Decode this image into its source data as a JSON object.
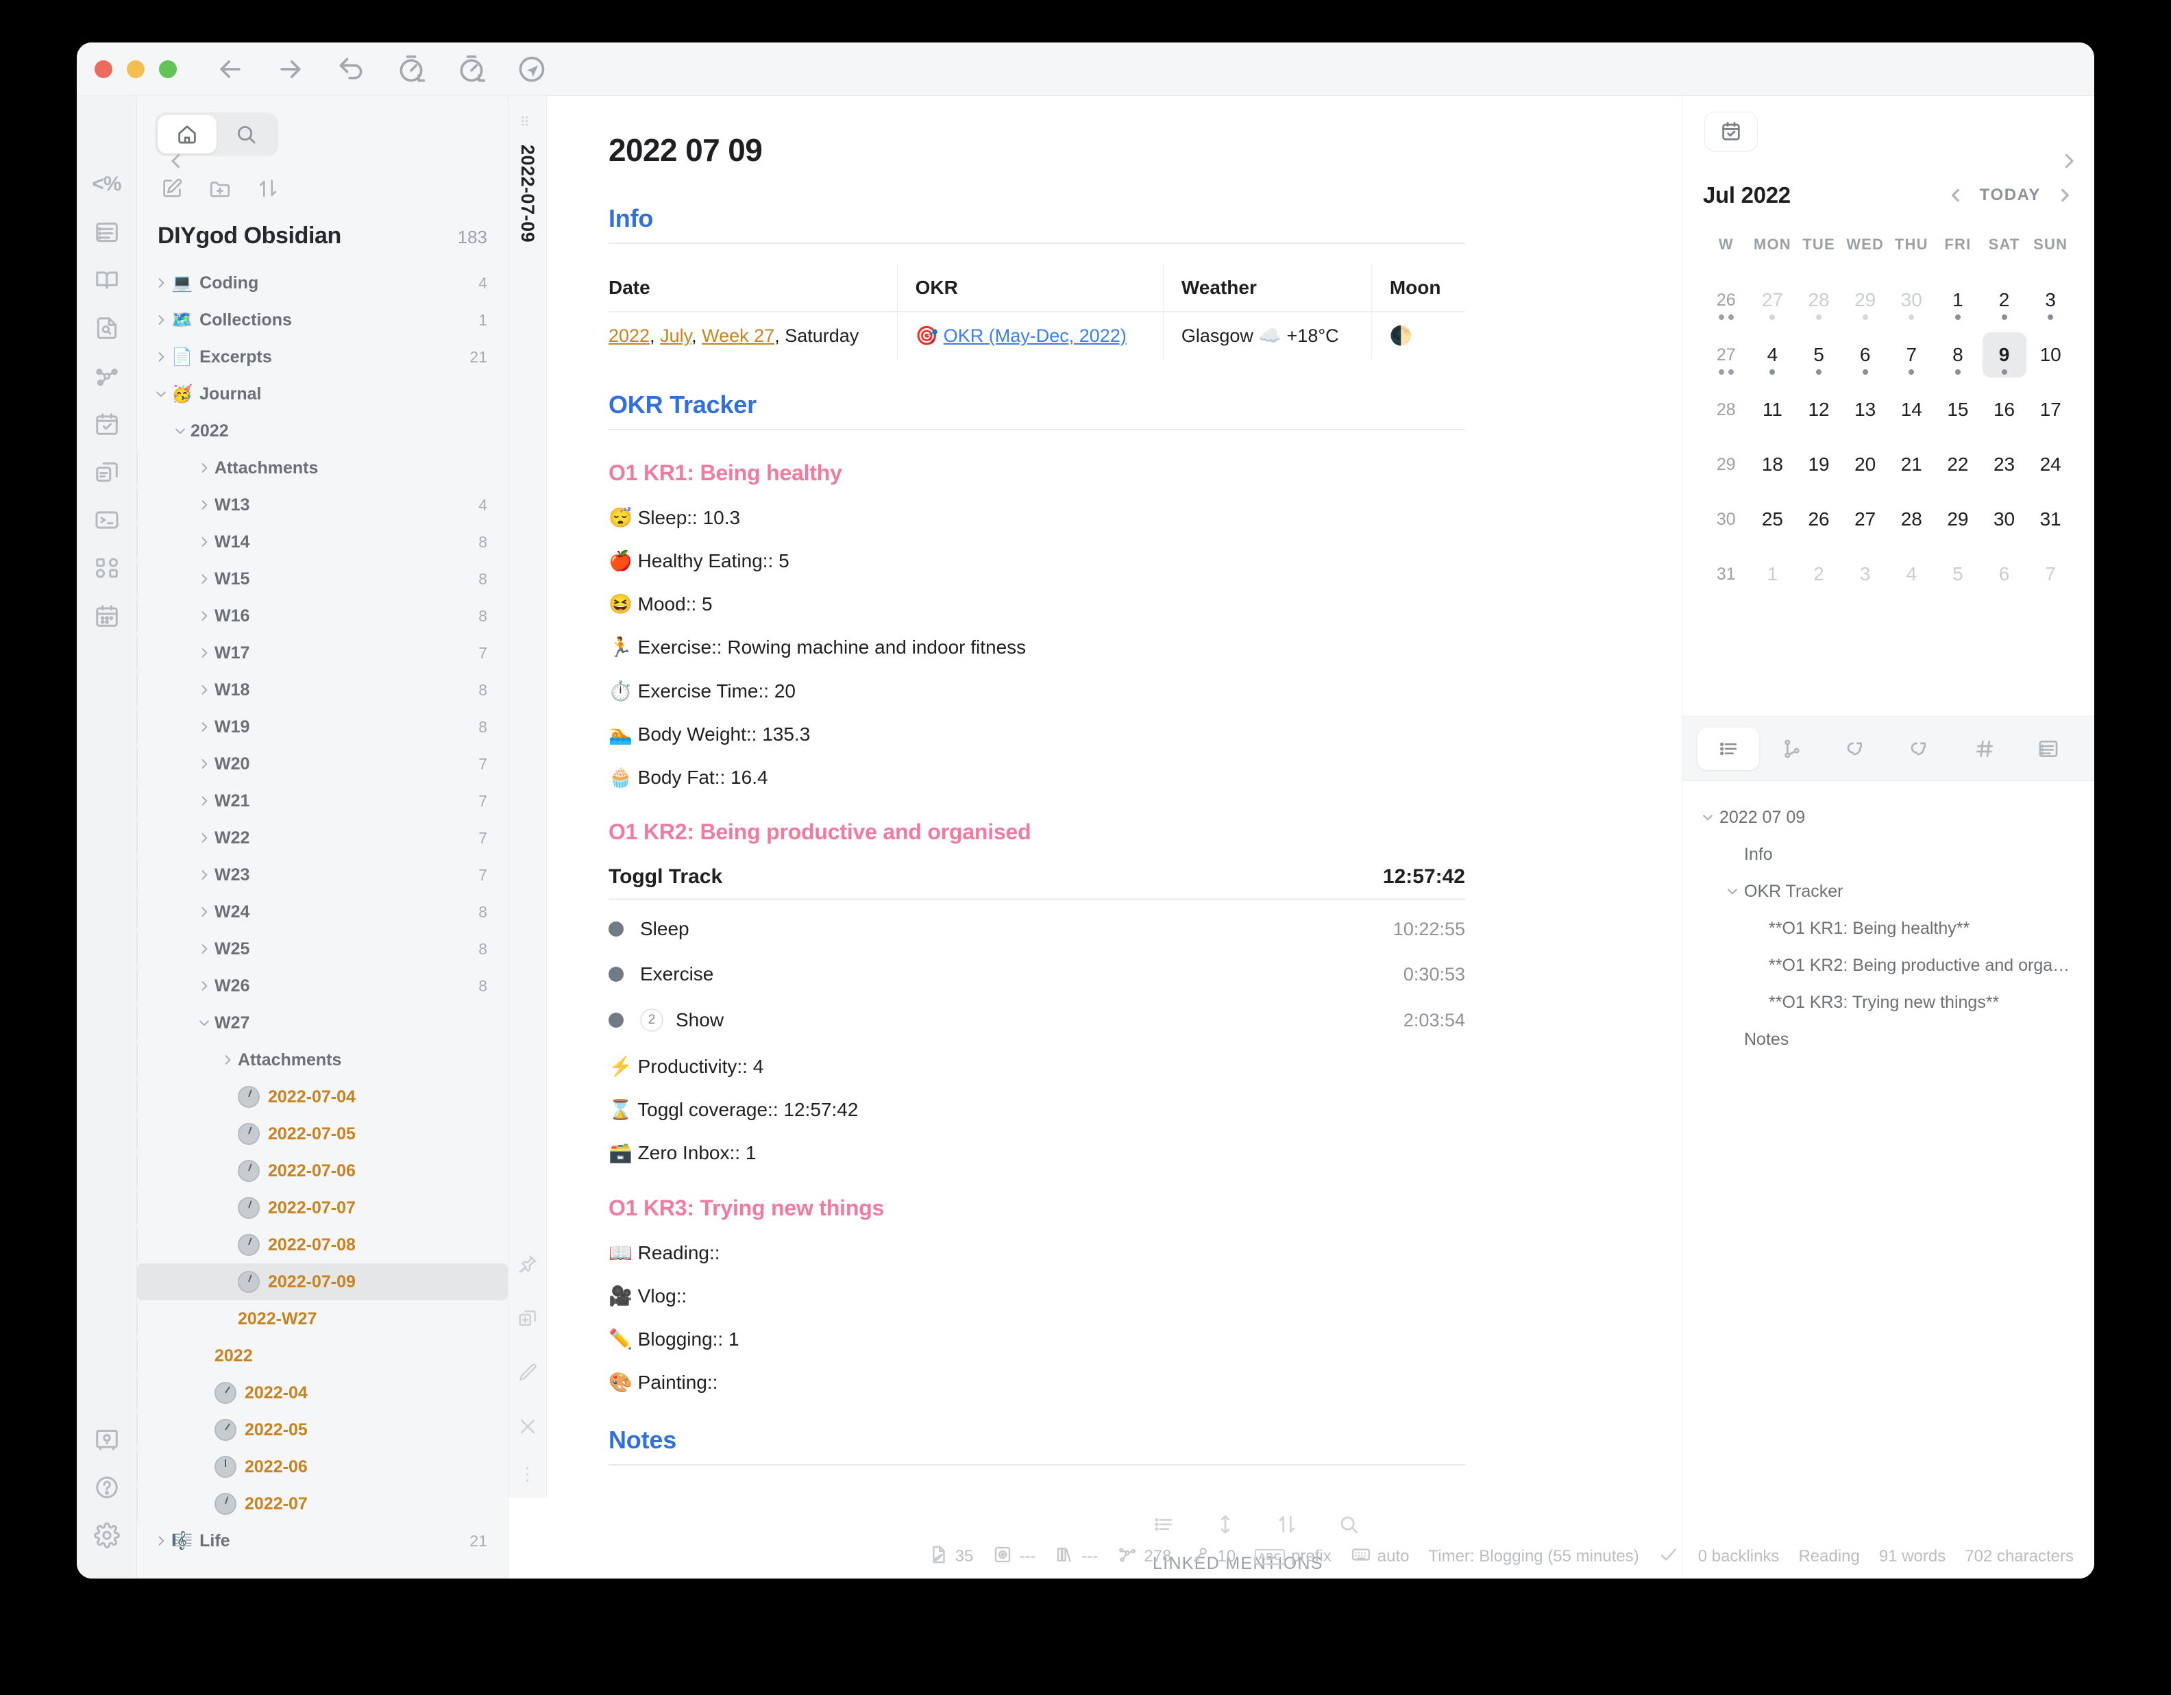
{
  "titlebar": {
    "nav": [
      "back-arrow",
      "forward-arrow",
      "undo-arrow",
      "redo-clock-a",
      "redo-clock-b",
      "navigate-circle"
    ]
  },
  "ribbon": {
    "items": [
      "list-panel-icon",
      "book-icon",
      "file-search-icon",
      "graph-icon",
      "calendar-check-icon",
      "copy-panes-icon",
      "terminal-icon",
      "blocks-icon",
      "calendar-days-icon"
    ],
    "bottom": [
      "vault-icon",
      "help-icon",
      "settings-icon"
    ],
    "percent_label": "<%"
  },
  "explorer": {
    "tabs": [
      "home-icon",
      "search-icon"
    ],
    "actions": [
      "new-note-icon",
      "new-folder-icon",
      "sort-icon"
    ],
    "vault_name": "DIYgod Obsidian",
    "vault_count": "183",
    "tree": [
      {
        "label": "Coding",
        "emoji": "💻",
        "count": "4",
        "indent": 0,
        "chevron": "right",
        "type": "folder"
      },
      {
        "label": "Collections",
        "emoji": "🗺️",
        "count": "1",
        "indent": 0,
        "chevron": "right",
        "type": "folder"
      },
      {
        "label": "Excerpts",
        "emoji": "📄",
        "count": "21",
        "indent": 0,
        "chevron": "right",
        "type": "folder"
      },
      {
        "label": "Journal",
        "emoji": "🥳",
        "count": "",
        "indent": 0,
        "chevron": "down",
        "type": "folder"
      },
      {
        "label": "2022",
        "emoji": "",
        "count": "",
        "indent": 1,
        "chevron": "down",
        "type": "folder"
      },
      {
        "label": "Attachments",
        "emoji": "",
        "count": "",
        "indent": 2,
        "chevron": "right",
        "type": "folder"
      },
      {
        "label": "W13",
        "emoji": "",
        "count": "4",
        "indent": 2,
        "chevron": "right",
        "type": "folder"
      },
      {
        "label": "W14",
        "emoji": "",
        "count": "8",
        "indent": 2,
        "chevron": "right",
        "type": "folder"
      },
      {
        "label": "W15",
        "emoji": "",
        "count": "8",
        "indent": 2,
        "chevron": "right",
        "type": "folder"
      },
      {
        "label": "W16",
        "emoji": "",
        "count": "8",
        "indent": 2,
        "chevron": "right",
        "type": "folder"
      },
      {
        "label": "W17",
        "emoji": "",
        "count": "7",
        "indent": 2,
        "chevron": "right",
        "type": "folder"
      },
      {
        "label": "W18",
        "emoji": "",
        "count": "8",
        "indent": 2,
        "chevron": "right",
        "type": "folder"
      },
      {
        "label": "W19",
        "emoji": "",
        "count": "8",
        "indent": 2,
        "chevron": "right",
        "type": "folder"
      },
      {
        "label": "W20",
        "emoji": "",
        "count": "7",
        "indent": 2,
        "chevron": "right",
        "type": "folder"
      },
      {
        "label": "W21",
        "emoji": "",
        "count": "7",
        "indent": 2,
        "chevron": "right",
        "type": "folder"
      },
      {
        "label": "W22",
        "emoji": "",
        "count": "7",
        "indent": 2,
        "chevron": "right",
        "type": "folder"
      },
      {
        "label": "W23",
        "emoji": "",
        "count": "7",
        "indent": 2,
        "chevron": "right",
        "type": "folder"
      },
      {
        "label": "W24",
        "emoji": "",
        "count": "8",
        "indent": 2,
        "chevron": "right",
        "type": "folder"
      },
      {
        "label": "W25",
        "emoji": "",
        "count": "8",
        "indent": 2,
        "chevron": "right",
        "type": "folder"
      },
      {
        "label": "W26",
        "emoji": "",
        "count": "8",
        "indent": 2,
        "chevron": "right",
        "type": "folder"
      },
      {
        "label": "W27",
        "emoji": "",
        "count": "",
        "indent": 2,
        "chevron": "down",
        "type": "folder"
      },
      {
        "label": "Attachments",
        "emoji": "",
        "count": "",
        "indent": 3,
        "chevron": "right",
        "type": "folder"
      },
      {
        "label": "2022-07-04",
        "emoji": "",
        "count": "",
        "indent": 3,
        "chevron": "",
        "type": "file",
        "clock": "h1"
      },
      {
        "label": "2022-07-05",
        "emoji": "",
        "count": "",
        "indent": 3,
        "chevron": "",
        "type": "file",
        "clock": "h1"
      },
      {
        "label": "2022-07-06",
        "emoji": "",
        "count": "",
        "indent": 3,
        "chevron": "",
        "type": "file",
        "clock": "h1"
      },
      {
        "label": "2022-07-07",
        "emoji": "",
        "count": "",
        "indent": 3,
        "chevron": "",
        "type": "file",
        "clock": "h1"
      },
      {
        "label": "2022-07-08",
        "emoji": "",
        "count": "",
        "indent": 3,
        "chevron": "",
        "type": "file",
        "clock": "h1"
      },
      {
        "label": "2022-07-09",
        "emoji": "",
        "count": "",
        "indent": 3,
        "chevron": "",
        "type": "file",
        "clock": "h1",
        "selected": true
      },
      {
        "label": "2022-W27",
        "emoji": "",
        "count": "",
        "indent": 3,
        "chevron": "",
        "type": "file-plain"
      },
      {
        "label": "2022",
        "emoji": "",
        "count": "",
        "indent": 2,
        "chevron": "",
        "type": "file-plain"
      },
      {
        "label": "2022-04",
        "emoji": "",
        "count": "",
        "indent": 2,
        "chevron": "",
        "type": "file",
        "clock": "h2"
      },
      {
        "label": "2022-05",
        "emoji": "",
        "count": "",
        "indent": 2,
        "chevron": "",
        "type": "file",
        "clock": "h2"
      },
      {
        "label": "2022-06",
        "emoji": "",
        "count": "",
        "indent": 2,
        "chevron": "",
        "type": "file",
        "clock": "h3"
      },
      {
        "label": "2022-07",
        "emoji": "",
        "count": "",
        "indent": 2,
        "chevron": "",
        "type": "file",
        "clock": "h4"
      },
      {
        "label": "Life",
        "emoji": "🎼",
        "count": "21",
        "indent": 0,
        "chevron": "right",
        "type": "folder"
      }
    ]
  },
  "tab": {
    "vertical_label": "2022-07-09"
  },
  "document": {
    "title": "2022 07 09",
    "info_heading": "Info",
    "info_table": {
      "headers": [
        "Date",
        "OKR",
        "Weather",
        "Moon"
      ],
      "row": {
        "date_year": "2022",
        "date_month": "July",
        "date_week": "Week 27",
        "date_weekday": ", Saturday",
        "okr_emoji": "🎯",
        "okr_link": "OKR (May-Dec, 2022)",
        "weather": "Glasgow ☁️ +18°C",
        "moon": "🌓"
      }
    },
    "okr_heading": "OKR Tracker",
    "kr1": {
      "title": "O1 KR1: Being healthy",
      "items": [
        {
          "emoji": "😴",
          "text": "Sleep:: 10.3"
        },
        {
          "emoji": "🍎",
          "text": "Healthy Eating:: 5"
        },
        {
          "emoji": "😆",
          "text": "Mood:: 5"
        },
        {
          "emoji": "🏃",
          "text": "Exercise:: Rowing machine and indoor fitness"
        },
        {
          "emoji": "⏱️",
          "text": "Exercise Time:: 20"
        },
        {
          "emoji": "🏊",
          "text": "Body Weight:: 135.3"
        },
        {
          "emoji": "🧁",
          "text": "Body Fat:: 16.4"
        }
      ]
    },
    "kr2": {
      "title": "O1 KR2: Being productive and organised",
      "toggl_label": "Toggl Track",
      "toggl_total": "12:57:42",
      "toggl_rows": [
        {
          "name": "Sleep",
          "time": "10:22:55",
          "badge": ""
        },
        {
          "name": "Exercise",
          "time": "0:30:53",
          "badge": ""
        },
        {
          "name": "Show",
          "time": "2:03:54",
          "badge": "2"
        }
      ],
      "items": [
        {
          "emoji": "⚡",
          "text": "Productivity:: 4"
        },
        {
          "emoji": "⌛",
          "text": "Toggl coverage:: 12:57:42"
        },
        {
          "emoji": "🗃️",
          "text": "Zero Inbox:: 1"
        }
      ]
    },
    "kr3": {
      "title": "O1 KR3: Trying new things",
      "items": [
        {
          "emoji": "📖",
          "text": "Reading::"
        },
        {
          "emoji": "🎥",
          "text": "Vlog::"
        },
        {
          "emoji": "✏️",
          "text": "Blogging:: 1"
        },
        {
          "emoji": "🎨",
          "text": "Painting::"
        }
      ]
    },
    "notes_heading": "Notes",
    "linked_mentions": "LINKED MENTIONS"
  },
  "editor_toolbar": [
    "list-icon",
    "vertical-resize-icon",
    "sort-updown-icon",
    "search-icon"
  ],
  "tab_tools": [
    "pin-icon",
    "add-pane-icon",
    "pencil-icon",
    "close-icon",
    "more-dots-icon"
  ],
  "statusbar": [
    {
      "icon": "note-edit-icon",
      "text": "35"
    },
    {
      "icon": "vault-icon",
      "text": "---"
    },
    {
      "icon": "books-icon",
      "text": "---"
    },
    {
      "icon": "graph-icon",
      "text": "278"
    },
    {
      "icon": "key-icon",
      "text": "10"
    },
    {
      "icon": "abc-icon",
      "text": "prefix"
    },
    {
      "icon": "keyboard-icon",
      "text": "auto"
    },
    {
      "icon": "",
      "text": "Timer: Blogging (55 minutes)"
    },
    {
      "icon": "check-icon",
      "text": ""
    },
    {
      "icon": "",
      "text": "0 backlinks"
    },
    {
      "icon": "",
      "text": "Reading"
    },
    {
      "icon": "",
      "text": "91 words"
    },
    {
      "icon": "",
      "text": "702 characters"
    }
  ],
  "right_panel": {
    "header_icon": "calendar-check-icon",
    "calendar": {
      "title": "Jul 2022",
      "today_label": "TODAY",
      "weekdays": [
        "W",
        "MON",
        "TUE",
        "WED",
        "THU",
        "FRI",
        "SAT",
        "SUN"
      ],
      "weeks": [
        {
          "w": "26",
          "wdots": 2,
          "days": [
            {
              "d": "27",
              "out": true,
              "dot": "faint"
            },
            {
              "d": "28",
              "out": true,
              "dot": "faint"
            },
            {
              "d": "29",
              "out": true,
              "dot": "faint"
            },
            {
              "d": "30",
              "out": true,
              "dot": "faint"
            },
            {
              "d": "1",
              "dot": "solid"
            },
            {
              "d": "2",
              "dot": "solid"
            },
            {
              "d": "3",
              "dot": "solid"
            }
          ]
        },
        {
          "w": "27",
          "wdots": 2,
          "days": [
            {
              "d": "4",
              "dot": "solid"
            },
            {
              "d": "5",
              "dot": "solid"
            },
            {
              "d": "6",
              "dot": "solid"
            },
            {
              "d": "7",
              "dot": "solid"
            },
            {
              "d": "8",
              "dot": "solid"
            },
            {
              "d": "9",
              "dot": "solid",
              "today": true
            },
            {
              "d": "10"
            }
          ]
        },
        {
          "w": "28",
          "days": [
            {
              "d": "11"
            },
            {
              "d": "12"
            },
            {
              "d": "13"
            },
            {
              "d": "14"
            },
            {
              "d": "15"
            },
            {
              "d": "16"
            },
            {
              "d": "17"
            }
          ]
        },
        {
          "w": "29",
          "days": [
            {
              "d": "18"
            },
            {
              "d": "19"
            },
            {
              "d": "20"
            },
            {
              "d": "21"
            },
            {
              "d": "22"
            },
            {
              "d": "23"
            },
            {
              "d": "24"
            }
          ]
        },
        {
          "w": "30",
          "days": [
            {
              "d": "25"
            },
            {
              "d": "26"
            },
            {
              "d": "27"
            },
            {
              "d": "28"
            },
            {
              "d": "29"
            },
            {
              "d": "30"
            },
            {
              "d": "31"
            }
          ]
        },
        {
          "w": "31",
          "days": [
            {
              "d": "1",
              "out": true
            },
            {
              "d": "2",
              "out": true
            },
            {
              "d": "3",
              "out": true
            },
            {
              "d": "4",
              "out": true
            },
            {
              "d": "5",
              "out": true
            },
            {
              "d": "6",
              "out": true
            },
            {
              "d": "7",
              "out": true
            }
          ]
        }
      ]
    },
    "outline_tabs": [
      "outline-list-icon",
      "backlinks-icon",
      "outgoing-links-icon",
      "incoming-links-icon",
      "tags-icon",
      "properties-icon"
    ],
    "outline": [
      {
        "text": "2022 07 09",
        "level": 0,
        "chevron": "down"
      },
      {
        "text": "Info",
        "level": 1,
        "chevron": ""
      },
      {
        "text": "OKR Tracker",
        "level": 1,
        "chevron": "down"
      },
      {
        "text": "**O1 KR1: Being healthy**",
        "level": 2,
        "chevron": ""
      },
      {
        "text": "**O1 KR2: Being productive and orga…",
        "level": 2,
        "chevron": ""
      },
      {
        "text": "**O1 KR3: Trying new things**",
        "level": 2,
        "chevron": ""
      },
      {
        "text": "Notes",
        "level": 1,
        "chevron": ""
      }
    ]
  }
}
